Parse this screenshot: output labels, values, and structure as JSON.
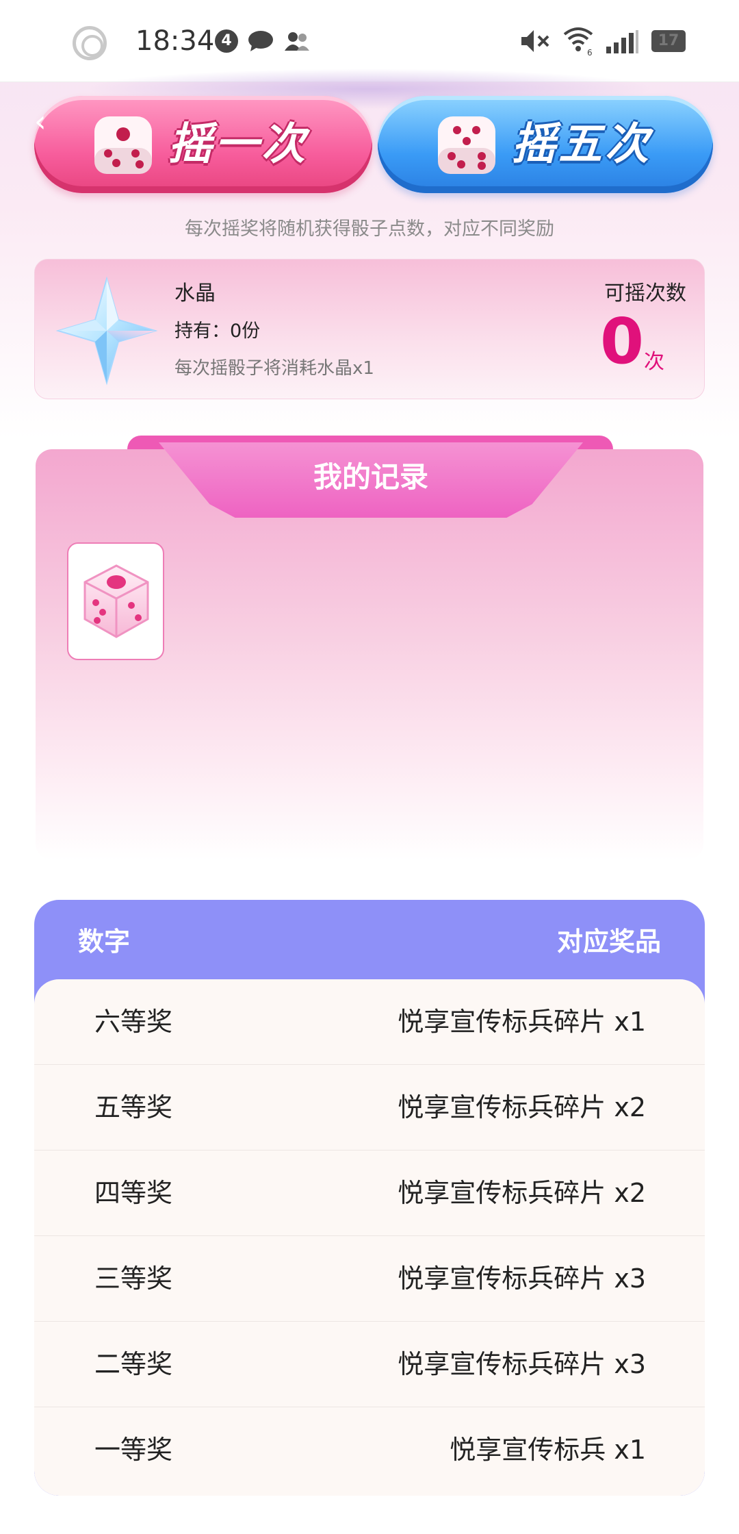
{
  "status_bar": {
    "time": "18:34",
    "notification_count": "4",
    "battery": "17"
  },
  "actions": {
    "shake_once_label": "摇一次",
    "shake_five_label": "摇五次",
    "hint": "每次摇奖将随机获得骰子点数，对应不同奖励"
  },
  "crystal": {
    "name": "水晶",
    "holding": "持有：0份",
    "note": "每次摇骰子将消耗水晶x1",
    "remaining_label": "可摇次数",
    "remaining_count": "0",
    "remaining_unit": "次"
  },
  "records": {
    "title": "我的记录"
  },
  "prize_table": {
    "header_left": "数字",
    "header_right": "对应奖品",
    "rows": [
      {
        "rank": "六等奖",
        "reward": "悦享宣传标兵碎片 x1"
      },
      {
        "rank": "五等奖",
        "reward": "悦享宣传标兵碎片 x2"
      },
      {
        "rank": "四等奖",
        "reward": "悦享宣传标兵碎片 x2"
      },
      {
        "rank": "三等奖",
        "reward": "悦享宣传标兵碎片 x3"
      },
      {
        "rank": "二等奖",
        "reward": "悦享宣传标兵碎片 x3"
      },
      {
        "rank": "一等奖",
        "reward": "悦享宣传标兵 x1"
      }
    ]
  },
  "colors": {
    "accent_pink": "#e0117b",
    "button_pink": "#f75d9c",
    "button_blue": "#3a9bf6",
    "table_header": "#8e90f8"
  },
  "icons": {
    "status": [
      "circle-app-icon",
      "chat-icon",
      "people-icon",
      "mute-icon",
      "wifi-icon",
      "signal-icon",
      "battery-icon"
    ],
    "content": [
      "back-chevron-icon",
      "dice-icon",
      "crystal-star-icon"
    ]
  }
}
